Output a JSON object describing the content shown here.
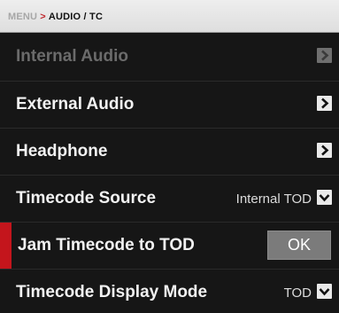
{
  "breadcrumb": {
    "root": "MENU",
    "separator": ">",
    "current": "AUDIO / TC"
  },
  "menu": {
    "items": [
      {
        "label": "Internal Audio",
        "control": "chevron",
        "enabled": false
      },
      {
        "label": "External Audio",
        "control": "chevron",
        "enabled": true
      },
      {
        "label": "Headphone",
        "control": "chevron",
        "enabled": true
      },
      {
        "label": "Timecode Source",
        "control": "dropdown",
        "value": "Internal TOD",
        "enabled": true
      },
      {
        "label": "Jam Timecode to TOD",
        "control": "button",
        "button_label": "OK",
        "enabled": true,
        "selected": true
      },
      {
        "label": "Timecode Display Mode",
        "control": "dropdown",
        "value": "TOD",
        "enabled": true
      }
    ]
  },
  "colors": {
    "accent": "#c4151c",
    "background": "#161616",
    "header_background": "#e6e6e6",
    "disabled_text": "#6b6b6b",
    "text": "#f2f2f2"
  },
  "icons": {
    "chevron": "chevron-right-icon",
    "dropdown": "chevron-down-icon"
  }
}
